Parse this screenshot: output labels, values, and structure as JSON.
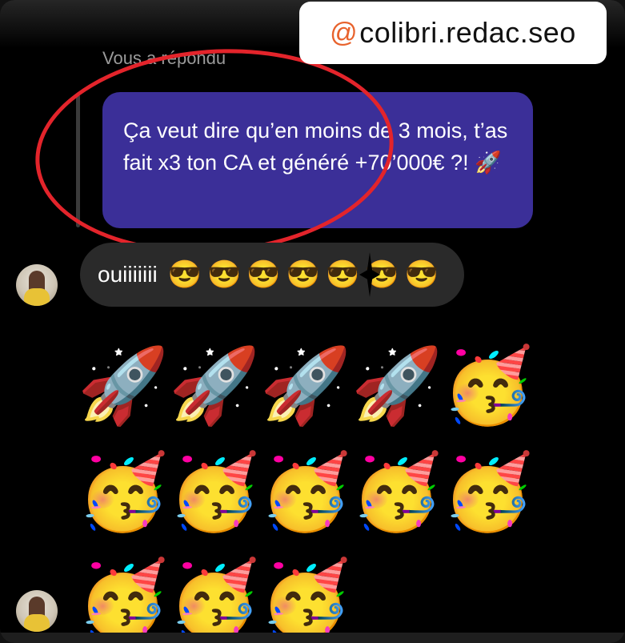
{
  "watermark": {
    "at_symbol": "@",
    "handle": "colibri.redac.seo"
  },
  "reply_context": {
    "label": "Vous a répondu",
    "quoted_message": "Ça veut dire qu’en moins de 3 mois, t’as fait x3 ton CA et généré +70’000€ ?! 🚀"
  },
  "message": {
    "text": "ouiiiiiii",
    "emojis": [
      "😎",
      "😎",
      "😎",
      "😎",
      "😎",
      "😎",
      "😎"
    ]
  },
  "emoji_message": {
    "emojis": [
      "🚀",
      "🚀",
      "🚀",
      "🚀",
      "🥳",
      "🥳",
      "🥳",
      "🥳",
      "🥳",
      "🥳",
      "🥳",
      "🥳",
      "🥳"
    ]
  },
  "colors": {
    "reply_bubble": "#3b2f98",
    "incoming_bubble": "#2a2a2a",
    "annotation": "#e3242b",
    "watermark_accent": "#e8622c"
  }
}
